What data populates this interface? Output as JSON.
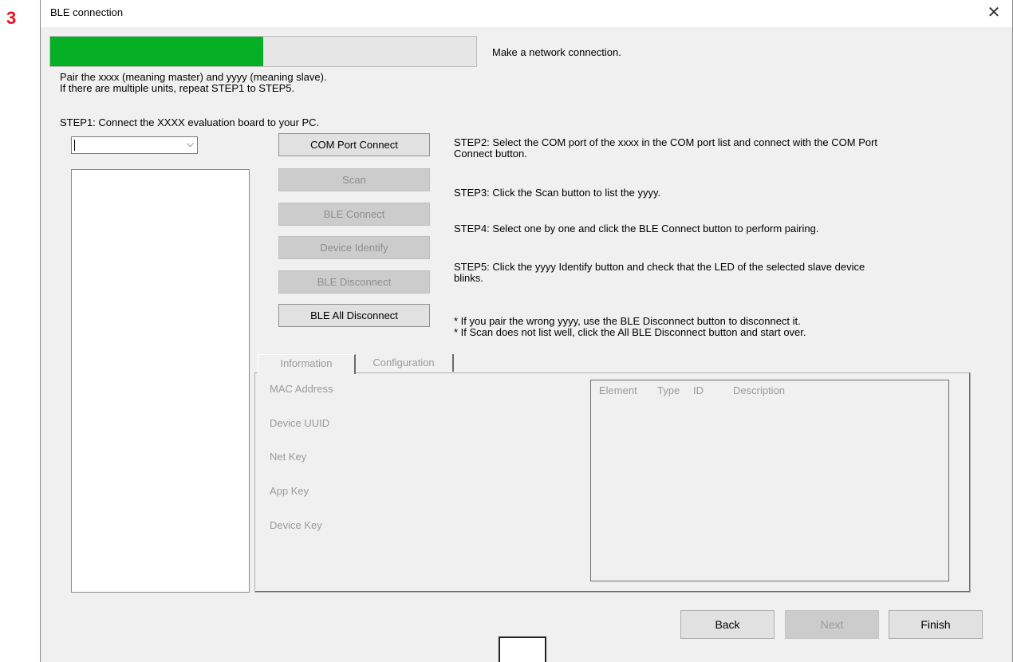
{
  "marker": "3",
  "window": {
    "title": "BLE connection",
    "close_symbol": "✕"
  },
  "progress": {
    "value_percent": 50,
    "fill_color": "#06b025",
    "caption": "Make a network connection."
  },
  "intro": {
    "line1": "Pair the xxxx (meaning master) and yyyy (meaning slave).",
    "line2": "If there are multiple units, repeat STEP1 to STEP5."
  },
  "step1": "STEP1: Connect the XXXX evaluation board to your PC.",
  "com_combo": {
    "value": ""
  },
  "buttons": {
    "com_port_connect": "COM Port Connect",
    "scan": "Scan",
    "ble_connect": "BLE Connect",
    "device_identify": "Device Identify",
    "ble_disconnect": "BLE Disconnect",
    "ble_all_disconnect": "BLE All Disconnect"
  },
  "steps": {
    "step2_line1": "STEP2: Select the COM port of the xxxx in the COM port list and connect with the COM Port",
    "step2_line2": "Connect button.",
    "step3": "STEP3: Click the Scan button to list the yyyy.",
    "step4": "STEP4: Select one by one and click the BLE Connect button to perform pairing.",
    "step5_line1": "STEP5: Click the yyyy Identify button and check that the LED of the selected slave device",
    "step5_line2": "blinks.",
    "note1": "* If you pair the wrong yyyy, use the BLE Disconnect button to disconnect it.",
    "note2": "* If Scan does not list well, click the All BLE Disconnect button and start over."
  },
  "tabs": [
    "Information",
    "Configuration"
  ],
  "info_fields": [
    "MAC Address",
    "Device UUID",
    "Net Key",
    "App Key",
    "Device Key"
  ],
  "element_table": {
    "columns": [
      "Element",
      "Type",
      "ID",
      "Description"
    ]
  },
  "footer": {
    "back": "Back",
    "next": "Next",
    "finish": "Finish"
  }
}
